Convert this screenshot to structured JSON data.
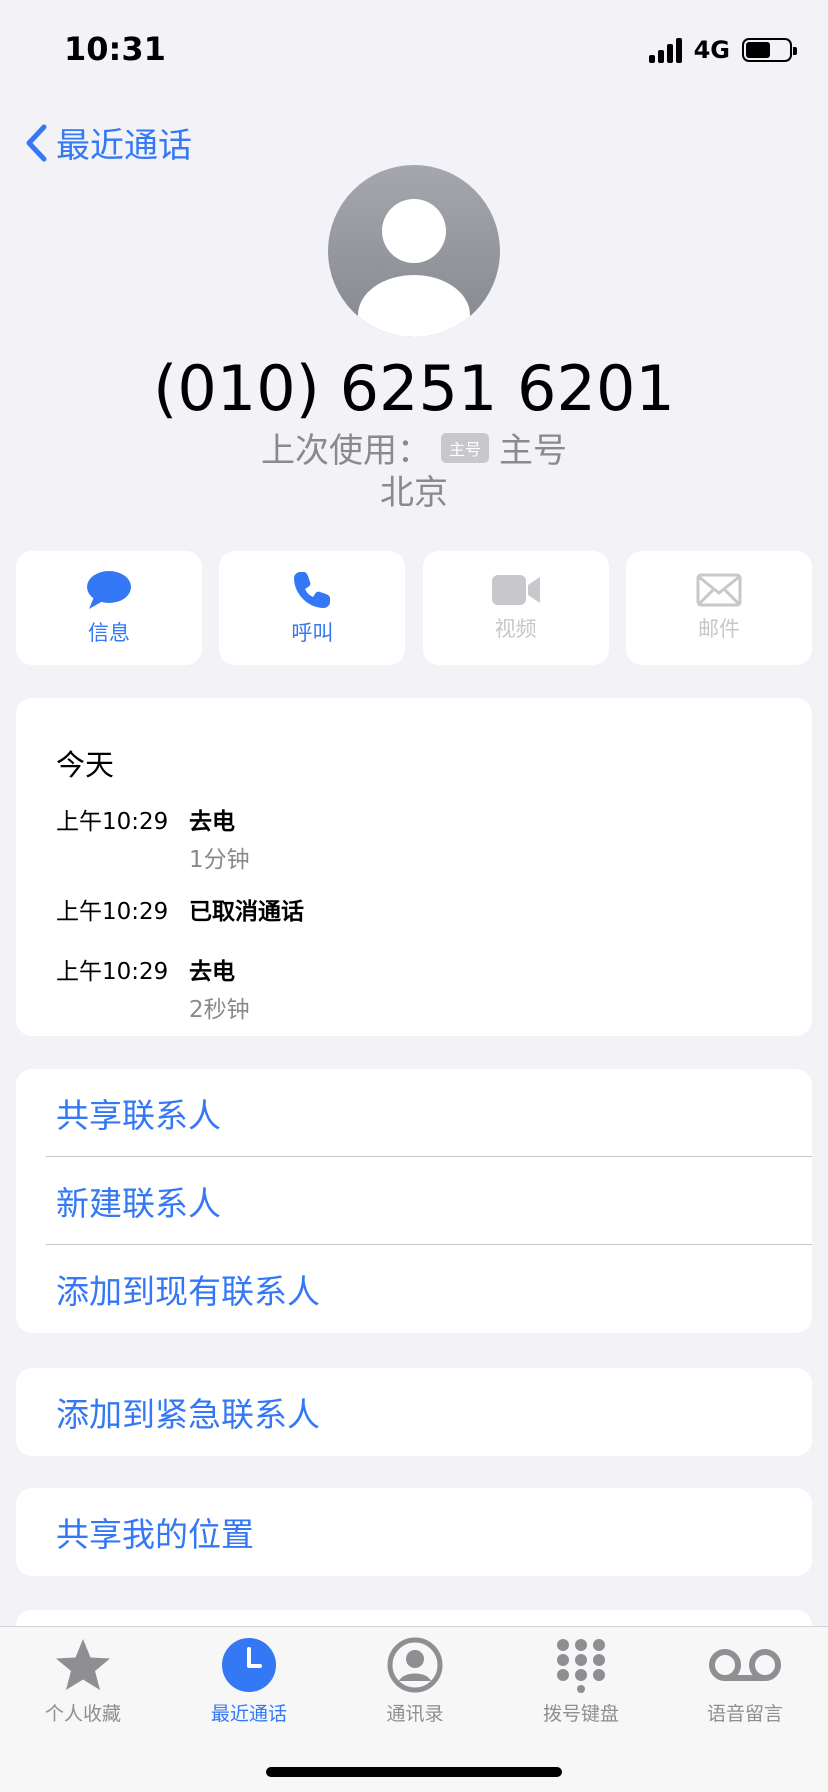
{
  "status_bar": {
    "time": "10:31",
    "network": "4G"
  },
  "nav": {
    "back_label": "最近通话"
  },
  "contact": {
    "phone_number": "(010) 6251 6201",
    "last_used_label": "上次使用：",
    "line_tag": "主号",
    "line_name": "主号",
    "location": "北京"
  },
  "actions": [
    {
      "label": "信息",
      "icon": "message-icon",
      "enabled": true
    },
    {
      "label": "呼叫",
      "icon": "phone-icon",
      "enabled": true
    },
    {
      "label": "视频",
      "icon": "video-icon",
      "enabled": false
    },
    {
      "label": "邮件",
      "icon": "mail-icon",
      "enabled": false
    }
  ],
  "history": {
    "title": "今天",
    "entries": [
      {
        "time": "上午10:29",
        "type": "去电",
        "duration": "1分钟"
      },
      {
        "time": "上午10:29",
        "type": "已取消通话",
        "duration": ""
      },
      {
        "time": "上午10:29",
        "type": "去电",
        "duration": "2秒钟"
      }
    ]
  },
  "menu": {
    "share_contact": "共享联系人",
    "new_contact": "新建联系人",
    "add_existing": "添加到现有联系人",
    "add_emergency": "添加到紧急联系人",
    "share_location": "共享我的位置"
  },
  "tabs": [
    {
      "label": "个人收藏",
      "icon": "star-icon"
    },
    {
      "label": "最近通话",
      "icon": "clock-icon",
      "active": true
    },
    {
      "label": "通讯录",
      "icon": "person-circle-icon"
    },
    {
      "label": "拨号键盘",
      "icon": "keypad-icon"
    },
    {
      "label": "语音留言",
      "icon": "voicemail-icon"
    }
  ],
  "colors": {
    "accent": "#3478f6",
    "background": "#f2f2f7",
    "secondary_text": "#8a8a8e",
    "disabled": "#c7c7cc"
  }
}
